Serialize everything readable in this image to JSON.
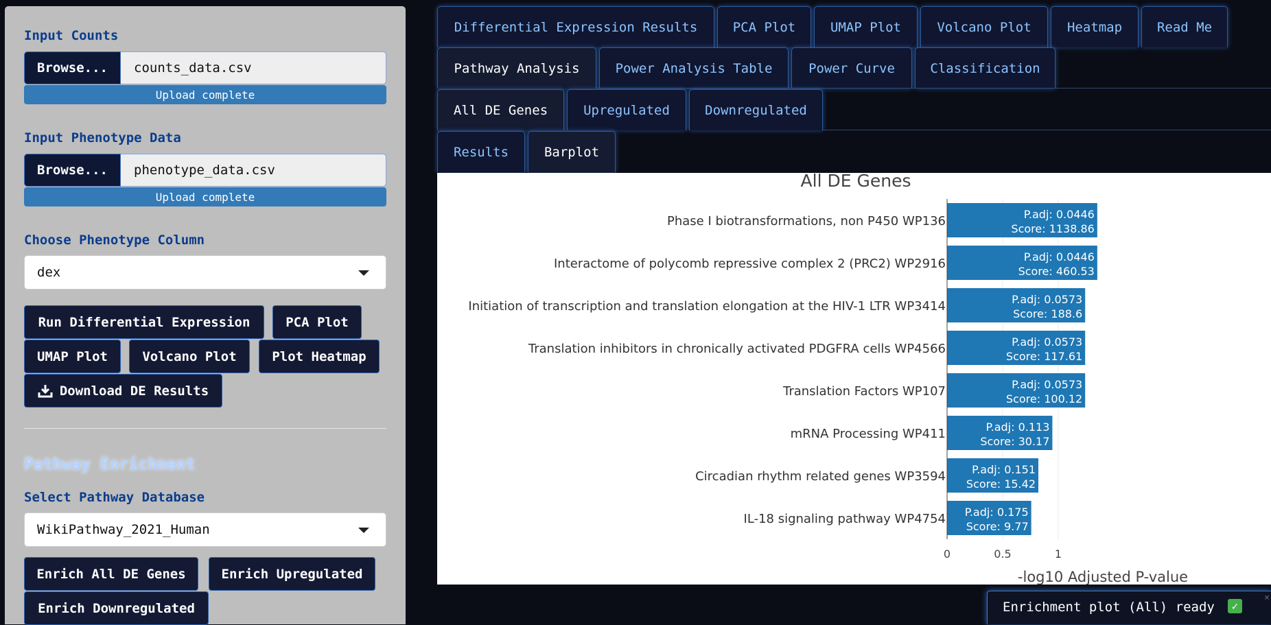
{
  "sidebar": {
    "counts": {
      "label": "Input Counts",
      "browse": "Browse...",
      "file": "counts_data.csv",
      "status": "Upload complete"
    },
    "pheno": {
      "label": "Input Phenotype Data",
      "browse": "Browse...",
      "file": "phenotype_data.csv",
      "status": "Upload complete"
    },
    "column": {
      "label": "Choose Phenotype Column",
      "value": "dex"
    },
    "buttons": {
      "run_de": "Run Differential Expression",
      "pca": "PCA Plot",
      "umap": "UMAP Plot",
      "volcano": "Volcano Plot",
      "heatmap": "Plot Heatmap",
      "download": "Download DE Results"
    },
    "pathway": {
      "heading": "Pathway Enrichment",
      "db_label": "Select Pathway Database",
      "db_value": "WikiPathway_2021_Human",
      "enrich_all": "Enrich All DE Genes",
      "enrich_up": "Enrich Upregulated",
      "enrich_down": "Enrich Downregulated"
    }
  },
  "tabs": {
    "row1": [
      "Differential Expression Results",
      "PCA Plot",
      "UMAP Plot",
      "Volcano Plot",
      "Heatmap",
      "Read Me"
    ],
    "row2": [
      "Pathway Analysis",
      "Power Analysis Table",
      "Power Curve",
      "Classification"
    ],
    "sub": [
      "All DE Genes",
      "Upregulated",
      "Downregulated"
    ],
    "view": [
      "Results",
      "Barplot"
    ]
  },
  "chart_data": {
    "type": "bar",
    "orientation": "horizontal",
    "title": "All DE Genes",
    "xlabel": "-log10 Adjusted P-value",
    "ylabel": "",
    "xlim": [
      0,
      1.45
    ],
    "xticks": [
      0,
      0.5,
      1
    ],
    "xtick_labels": [
      "0",
      "0.5",
      "1"
    ],
    "grid": true,
    "bar_color": "#1f77b4",
    "categories": [
      "Phase I biotransformations, non P450 WP136",
      "Interactome of polycomb repressive complex 2 (PRC2)  WP2916",
      "Initiation of transcription and translation elongation at the HIV-1 LTR WP3414",
      "Translation inhibitors in chronically activated PDGFRA cells WP4566",
      "Translation Factors WP107",
      "mRNA Processing WP411",
      "Circadian rhythm related genes WP3594",
      "IL-18 signaling pathway WP4754"
    ],
    "values": [
      1.351,
      1.351,
      1.242,
      1.242,
      1.242,
      0.947,
      0.821,
      0.757
    ],
    "padj_labels": [
      "P.adj: 0.0446",
      "P.adj: 0.0446",
      "P.adj: 0.0573",
      "P.adj: 0.0573",
      "P.adj: 0.0573",
      "P.adj: 0.113",
      "P.adj: 0.151",
      "P.adj: 0.175"
    ],
    "score_labels": [
      "Score: 1138.86",
      "Score: 460.53",
      "Score: 188.6",
      "Score: 117.61",
      "Score: 100.12",
      "Score: 30.17",
      "Score: 15.42",
      "Score: 9.77"
    ]
  },
  "toast": {
    "message": "Enrichment plot (All) ready",
    "icon": "check-mark-icon",
    "close": "×"
  },
  "colors": {
    "sidebar_bg": "#bebebe",
    "label": "#0b3c8c",
    "button_bg": "#141a33",
    "progress": "#337ab7",
    "tab_text": "#8cc4ff",
    "bar": "#1f77b4"
  }
}
